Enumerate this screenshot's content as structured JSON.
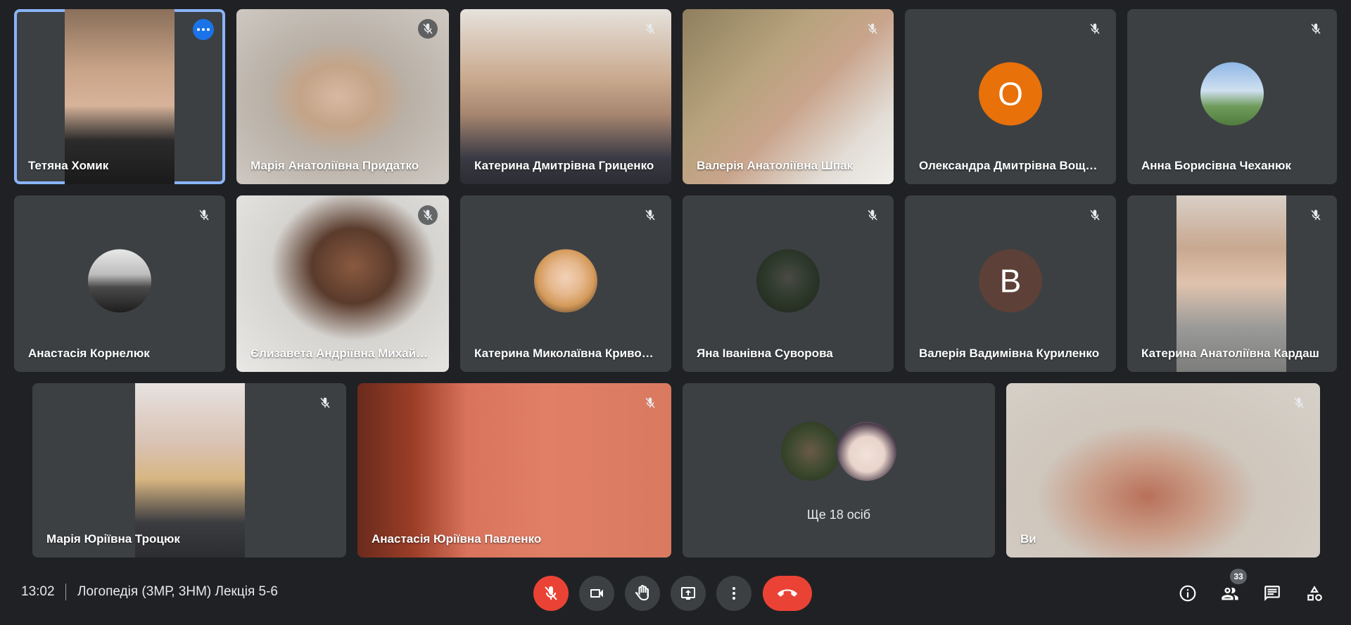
{
  "meeting": {
    "time": "13:02",
    "title": "Логопедія (3МР, 3НМ) Лекція 5-6"
  },
  "participants": [
    {
      "name": "Тетяна Хомик",
      "type": "video",
      "speaking": true,
      "icon": "more-options-icon"
    },
    {
      "name": "Марія Анатоліївна Придатко",
      "type": "video",
      "icon": "mic-off-icon"
    },
    {
      "name": "Катерина Дмитрівна Гриценко",
      "type": "video",
      "icon": "mic-off-icon"
    },
    {
      "name": "Валерія Анатоліївна Шпак",
      "type": "video",
      "icon": "mic-off-icon"
    },
    {
      "name": "Олександра Дмитрівна Вощенко",
      "type": "letter-avatar",
      "letter": "О",
      "color": "#e8710a",
      "icon": "mic-off-icon"
    },
    {
      "name": "Анна Борисівна Чеханюк",
      "type": "photo-avatar",
      "icon": "mic-off-icon"
    },
    {
      "name": "Анастасія Корнелюк",
      "type": "photo-avatar",
      "icon": "mic-off-icon"
    },
    {
      "name": "Єлизавета Андріївна Михайлюк",
      "type": "video",
      "icon": "mic-off-icon"
    },
    {
      "name": "Катерина Миколаївна Кривошеєва",
      "type": "photo-avatar",
      "icon": "mic-off-icon"
    },
    {
      "name": "Яна Іванівна Суворова",
      "type": "photo-avatar",
      "icon": "mic-off-icon"
    },
    {
      "name": "Валерія Вадимівна Куриленко",
      "type": "letter-avatar",
      "letter": "В",
      "color": "#5d4037",
      "icon": "mic-off-icon"
    },
    {
      "name": "Катерина Анатоліївна Кардаш",
      "type": "video",
      "icon": "mic-off-icon"
    },
    {
      "name": "Марія Юріївна Троцюк",
      "type": "video",
      "icon": "mic-off-icon"
    },
    {
      "name": "Анастасія Юріївна Павленко",
      "type": "video",
      "icon": "mic-off-icon"
    },
    {
      "name": "",
      "type": "more",
      "more_label": "Ще 18 осіб"
    },
    {
      "name": "Ви",
      "type": "video",
      "icon": "mic-off-icon"
    }
  ],
  "controls": [
    "mic-off-icon",
    "camera-icon",
    "raise-hand-icon",
    "present-icon",
    "more-vert-icon",
    "hang-up-icon"
  ],
  "right_controls": {
    "people_count": "33",
    "icons": [
      "info-icon",
      "people-icon",
      "chat-icon",
      "activities-icon"
    ]
  },
  "colors": {
    "background": "#202124",
    "tile": "#3c4043",
    "accent": "#8ab4f8",
    "danger": "#ea4335"
  }
}
